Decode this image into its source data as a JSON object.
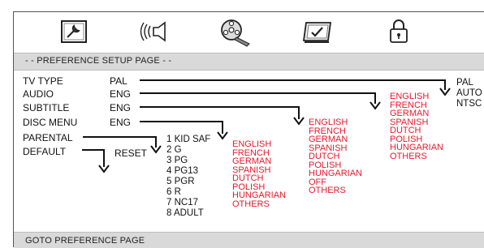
{
  "tabs": [
    {
      "name": "general-setup-icon"
    },
    {
      "name": "audio-setup-icon"
    },
    {
      "name": "video-setup-icon"
    },
    {
      "name": "preference-setup-icon"
    },
    {
      "name": "password-lock-icon"
    }
  ],
  "header": {
    "title": "- - PREFERENCE SETUP PAGE - -"
  },
  "items": [
    {
      "label": "TV TYPE",
      "value": "PAL"
    },
    {
      "label": "AUDIO",
      "value": "ENG"
    },
    {
      "label": "SUBTITLE",
      "value": "ENG"
    },
    {
      "label": "DISC MENU",
      "value": "ENG"
    },
    {
      "label": "PARENTAL",
      "value": ""
    },
    {
      "label": "DEFAULT",
      "value": ""
    }
  ],
  "reset_label": "RESET",
  "tv_type_options": [
    "PAL",
    "AUTO",
    "NTSC"
  ],
  "audio_options": [
    "ENGLISH",
    "FRENCH",
    "GERMAN",
    "SPANISH",
    "DUTCH",
    "POLISH",
    "HUNGARIAN",
    "OTHERS"
  ],
  "subtitle_options": [
    "ENGLISH",
    "FRENCH",
    "GERMAN",
    "SPANISH",
    "DUTCH",
    "POLISH",
    "HUNGARIAN",
    "OFF",
    "OTHERS"
  ],
  "disc_menu_options": [
    "ENGLISH",
    "FRENCH",
    "GERMAN",
    "SPANISH",
    "DUTCH",
    "POLISH",
    "HUNGARIAN",
    "OTHERS"
  ],
  "parental_options": [
    "1 KID SAF",
    "2 G",
    "3 PG",
    "4 PG13",
    "5 PGR",
    "6 R",
    "7 NC17",
    "8 ADULT"
  ],
  "footer": {
    "text": "GOTO PREFERENCE PAGE"
  },
  "colors": {
    "option_red": "#e8192c",
    "bar_gray": "#d9d9d9"
  }
}
